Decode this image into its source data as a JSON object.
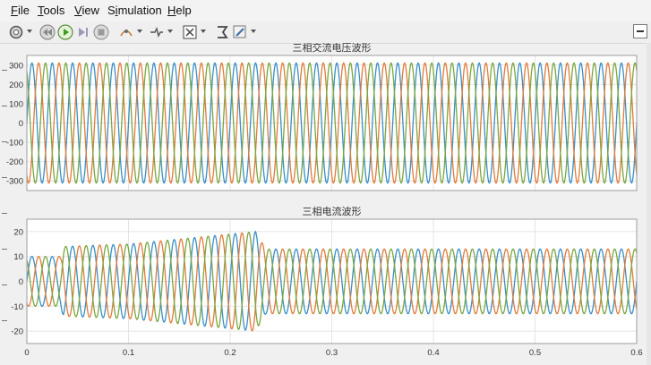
{
  "menu": [
    {
      "key": "F",
      "rest": "ile"
    },
    {
      "key": "T",
      "rest": "ools"
    },
    {
      "key": "V",
      "rest": "iew"
    },
    {
      "pre": "S",
      "key": "i",
      "rest": "mulation"
    },
    {
      "key": "H",
      "rest": "elp"
    }
  ],
  "toolbar": {
    "icons": [
      "gear-icon",
      "rewind-icon",
      "run-icon",
      "step-forward-icon",
      "stop-icon",
      "highlight-icon",
      "signal-selector-icon",
      "zoom-fit-icon",
      "style-icon",
      "edit-icon"
    ]
  },
  "colors": {
    "phase_a": "#3a8fc4",
    "phase_b": "#e07b39",
    "phase_c": "#7aa63f",
    "grid": "#e4e4e4",
    "axes_bg": "#ffffff"
  },
  "chart_data": [
    {
      "type": "line",
      "title": "三相交流电压波形",
      "xlim": [
        0,
        0.6
      ],
      "ylim": [
        -350,
        350
      ],
      "xticks": [
        0,
        0.1,
        0.2,
        0.3,
        0.4,
        0.5,
        0.6
      ],
      "yticks": [
        -300,
        -200,
        -100,
        0,
        100,
        200,
        300
      ],
      "ytick_labels": [
        "-300",
        "-200",
        "-100",
        "0",
        "100",
        "200",
        "300"
      ],
      "grid": true,
      "frequency_hz": 50,
      "series": [
        {
          "phase_deg": 0,
          "amplitude": [
            [
              0,
              311
            ],
            [
              0.6,
              311
            ]
          ]
        },
        {
          "phase_deg": -120,
          "amplitude": [
            [
              0,
              311
            ],
            [
              0.6,
              311
            ]
          ]
        },
        {
          "phase_deg": 120,
          "amplitude": [
            [
              0,
              311
            ],
            [
              0.6,
              311
            ]
          ]
        }
      ]
    },
    {
      "type": "line",
      "title": "三相电流波形",
      "xlim": [
        0,
        0.6
      ],
      "ylim": [
        -25,
        25
      ],
      "xticks": [
        0,
        0.1,
        0.2,
        0.3,
        0.4,
        0.5,
        0.6
      ],
      "yticks": [
        -20,
        -10,
        0,
        10,
        20
      ],
      "ytick_labels": [
        "-20",
        "-10",
        "0",
        "10",
        "20"
      ],
      "xtick_labels": [
        "0",
        "0.1",
        "0.2",
        "0.3",
        "0.4",
        "0.5",
        "0.6"
      ],
      "grid": true,
      "frequency_hz": 50,
      "series": [
        {
          "phase_deg": 0,
          "amplitude": [
            [
              0,
              10
            ],
            [
              0.033,
              10
            ],
            [
              0.036,
              14
            ],
            [
              0.1,
              15
            ],
            [
              0.225,
              20
            ],
            [
              0.235,
              13
            ],
            [
              0.6,
              13
            ]
          ]
        },
        {
          "phase_deg": -120,
          "amplitude": [
            [
              0,
              10
            ],
            [
              0.033,
              10
            ],
            [
              0.036,
              14
            ],
            [
              0.1,
              15
            ],
            [
              0.225,
              20
            ],
            [
              0.235,
              13
            ],
            [
              0.6,
              13
            ]
          ]
        },
        {
          "phase_deg": 120,
          "amplitude": [
            [
              0,
              10
            ],
            [
              0.033,
              10
            ],
            [
              0.036,
              14
            ],
            [
              0.1,
              15
            ],
            [
              0.225,
              20
            ],
            [
              0.235,
              13
            ],
            [
              0.6,
              13
            ]
          ]
        }
      ]
    }
  ]
}
